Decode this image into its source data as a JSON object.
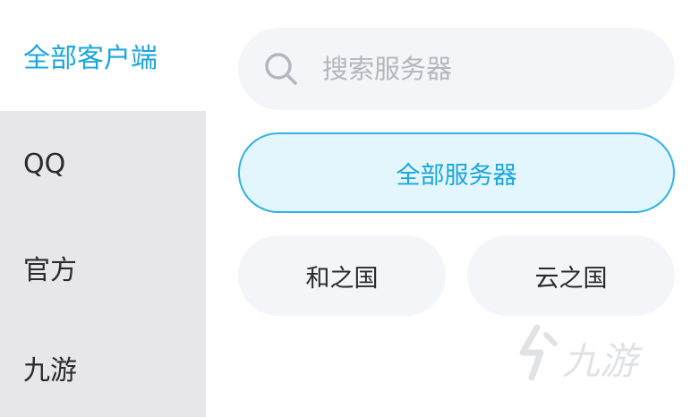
{
  "sidebar": {
    "items": [
      {
        "label": "全部客户端",
        "active": true
      },
      {
        "label": "QQ",
        "active": false
      },
      {
        "label": "官方",
        "active": false
      },
      {
        "label": "九游",
        "active": false
      }
    ]
  },
  "search": {
    "placeholder": "搜索服务器",
    "value": ""
  },
  "servers": {
    "all_label": "全部服务器",
    "items": [
      {
        "label": "和之国"
      },
      {
        "label": "云之国"
      }
    ]
  },
  "watermark": {
    "text": "九游"
  },
  "colors": {
    "accent": "#1aa6dc",
    "accent_border": "#2fb3e0",
    "accent_bg": "#e4f6fd",
    "sidebar_bg": "#e7e7ea",
    "chip_bg": "#f4f5f8"
  },
  "icons": {
    "search": "search-icon",
    "watermark": "jiuyou-logo-icon"
  }
}
